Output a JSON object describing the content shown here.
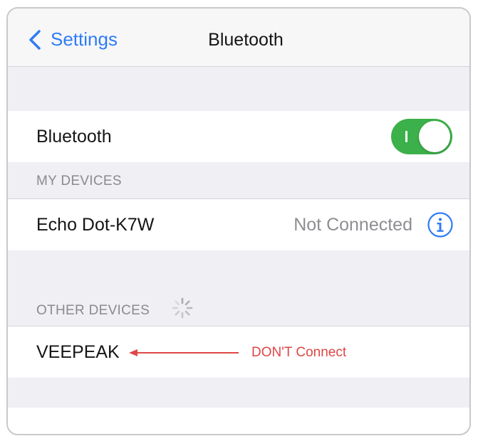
{
  "navbar": {
    "back_label": "Settings",
    "title": "Bluetooth"
  },
  "bluetooth_toggle": {
    "label": "Bluetooth",
    "on": true,
    "on_color": "#3cb04a"
  },
  "my_devices": {
    "header": "MY DEVICES",
    "items": [
      {
        "name": "Echo Dot-K7W",
        "status": "Not Connected",
        "icon": "info-icon"
      }
    ]
  },
  "other_devices": {
    "header": "OTHER DEVICES",
    "spinner_icon": "loading-spinner-icon",
    "items": [
      {
        "name": "VEEPEAK"
      }
    ]
  },
  "annotation": {
    "text": "DON'T Connect",
    "color": "#e04646"
  },
  "colors": {
    "accent": "#2f7cf6",
    "grouped_background": "#efeff4"
  }
}
